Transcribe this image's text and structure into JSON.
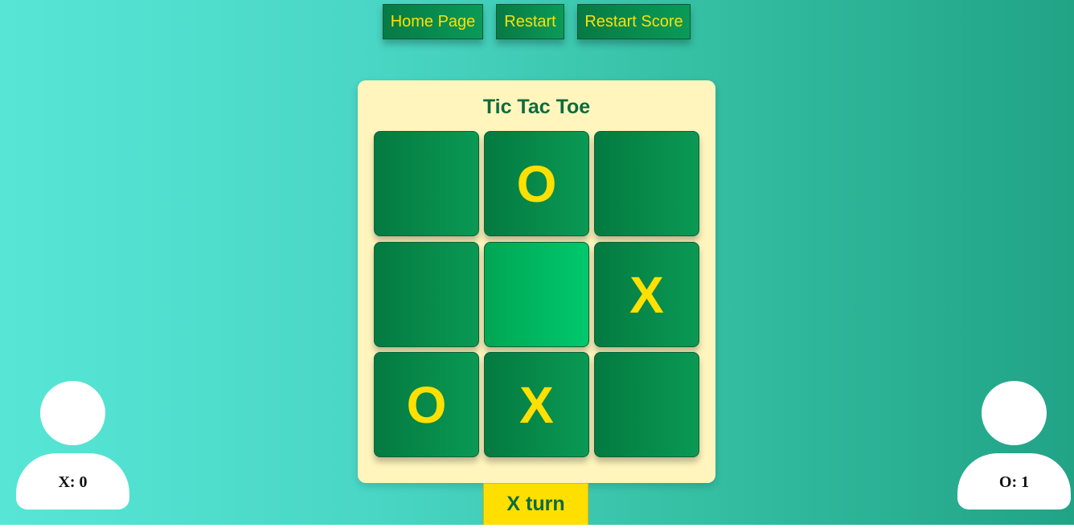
{
  "toolbar": {
    "home_label": "Home Page",
    "restart_label": "Restart",
    "restart_score_label": "Restart Score"
  },
  "board": {
    "title": "Tic Tac Toe",
    "cells": [
      "",
      "O",
      "",
      "",
      "",
      "X",
      "O",
      "X",
      ""
    ],
    "highlighted_cell": 4
  },
  "turn": {
    "label": "X turn"
  },
  "players": {
    "x": {
      "score_label": "X: 0",
      "icon": "user-avatar-icon"
    },
    "o": {
      "score_label": "O: 1",
      "icon": "user-avatar-icon"
    }
  },
  "colors": {
    "background_start": "#57e6d6",
    "background_end": "#21a386",
    "cell_green": "#047a40",
    "cell_highlight": "#00c86d",
    "mark_yellow": "#ffe000",
    "card": "#fff5bd",
    "title_green": "#0c6b3e",
    "turn_yellow": "#ffdf00"
  }
}
